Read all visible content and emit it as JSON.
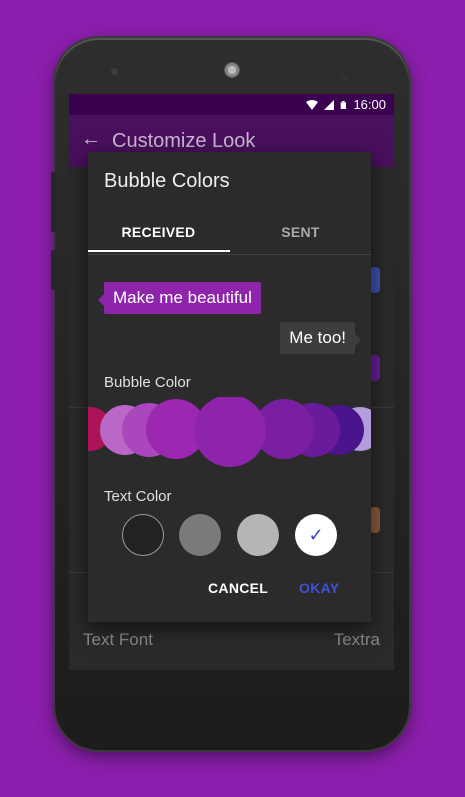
{
  "status_bar": {
    "time": "16:00",
    "icons": [
      "wifi-icon",
      "cell-signal-icon",
      "battery-icon"
    ]
  },
  "app_bar": {
    "title": "Customize Look",
    "back_icon": "arrow-back-icon"
  },
  "background_list": {
    "text_font_label": "Text Font",
    "text_font_value": "Textra"
  },
  "dialog": {
    "title": "Bubble Colors",
    "tabs": [
      {
        "label": "RECEIVED",
        "selected": true
      },
      {
        "label": "SENT",
        "selected": false
      }
    ],
    "preview": {
      "received_message": "Make me beautiful",
      "sent_message": "Me too!"
    },
    "bubble_color_label": "Bubble Color",
    "bubble_colors": [
      "#ad1457",
      "#ba68c8",
      "#ab47bc",
      "#9c27b0",
      "#8e24aa",
      "#7b1fa2",
      "#6a1b9a",
      "#4a148c",
      "#b39ddb"
    ],
    "selected_bubble_color": "#8e24aa",
    "text_color_label": "Text Color",
    "text_colors": [
      "#222222",
      "#7a7a7a",
      "#b5b5b5",
      "#ffffff"
    ],
    "selected_text_color": "#ffffff",
    "cancel_label": "CANCEL",
    "okay_label": "OKAY"
  },
  "colors": {
    "background": "#8c1fad",
    "accent_button": "#3f51d6",
    "status_bar": "#3c0050",
    "app_bar": "#4a0f5e"
  }
}
